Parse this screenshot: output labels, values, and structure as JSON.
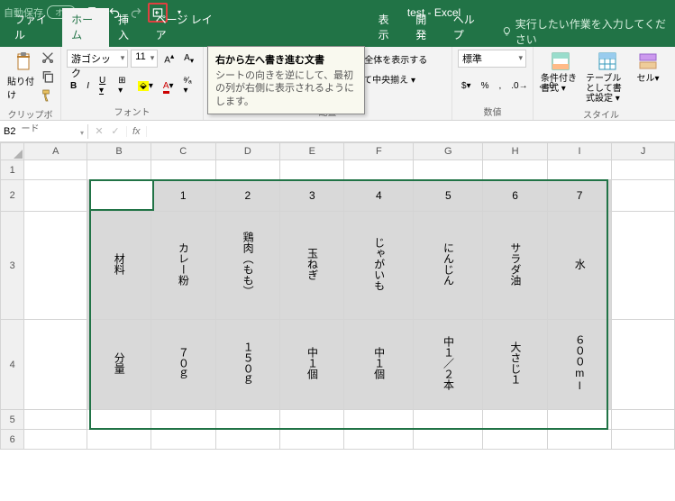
{
  "titlebar": {
    "autosave_label": "自動保存",
    "autosave_off": "オフ",
    "title": "test  -  Excel"
  },
  "tooltip": {
    "title": "右から左へ書き進む文書",
    "body": "シートの向きを逆にして、最初の列が右側に表示されるようにします。"
  },
  "tabs": {
    "file": "ファイル",
    "home": "ホーム",
    "insert": "挿入",
    "page_layout": "ページ レイア",
    "view": "表示",
    "developer": "開発",
    "help": "ヘルプ",
    "search": "実行したい作業を入力してください"
  },
  "ribbon": {
    "clipboard": {
      "paste": "貼り付け",
      "group": "クリップボード"
    },
    "font": {
      "name": "游ゴシック",
      "size": "11",
      "group": "フォント"
    },
    "alignment": {
      "group": "配置",
      "wrap": "折り返して全体を表示する",
      "merge": "セルを結合して中央揃え"
    },
    "number": {
      "group": "数値",
      "format": "標準"
    },
    "styles": {
      "cond_fmt": "条件付き書式",
      "fmt_table": "テーブルとして書式設定",
      "cell_styles": "セルのスタイル",
      "group": "スタイル"
    }
  },
  "namebox": "B2",
  "columns": [
    "A",
    "B",
    "C",
    "D",
    "E",
    "F",
    "G",
    "H",
    "I",
    "J"
  ],
  "rows": [
    "1",
    "2",
    "3",
    "4",
    "5",
    "6"
  ],
  "chart_data": {
    "type": "table",
    "headers": [
      "",
      "1",
      "2",
      "3",
      "4",
      "5",
      "6",
      "7"
    ],
    "row_labels": [
      "材料",
      "分量"
    ],
    "data": [
      [
        "カレー粉",
        "鶏肉（もも）",
        "玉ねぎ",
        "じゃがいも",
        "にんじん",
        "サラダ油",
        "水"
      ],
      [
        "７０ｇ",
        "１５０ｇ",
        "中１個",
        "中１個",
        "中１／２本",
        "大さじ１",
        "６００ml"
      ]
    ]
  }
}
